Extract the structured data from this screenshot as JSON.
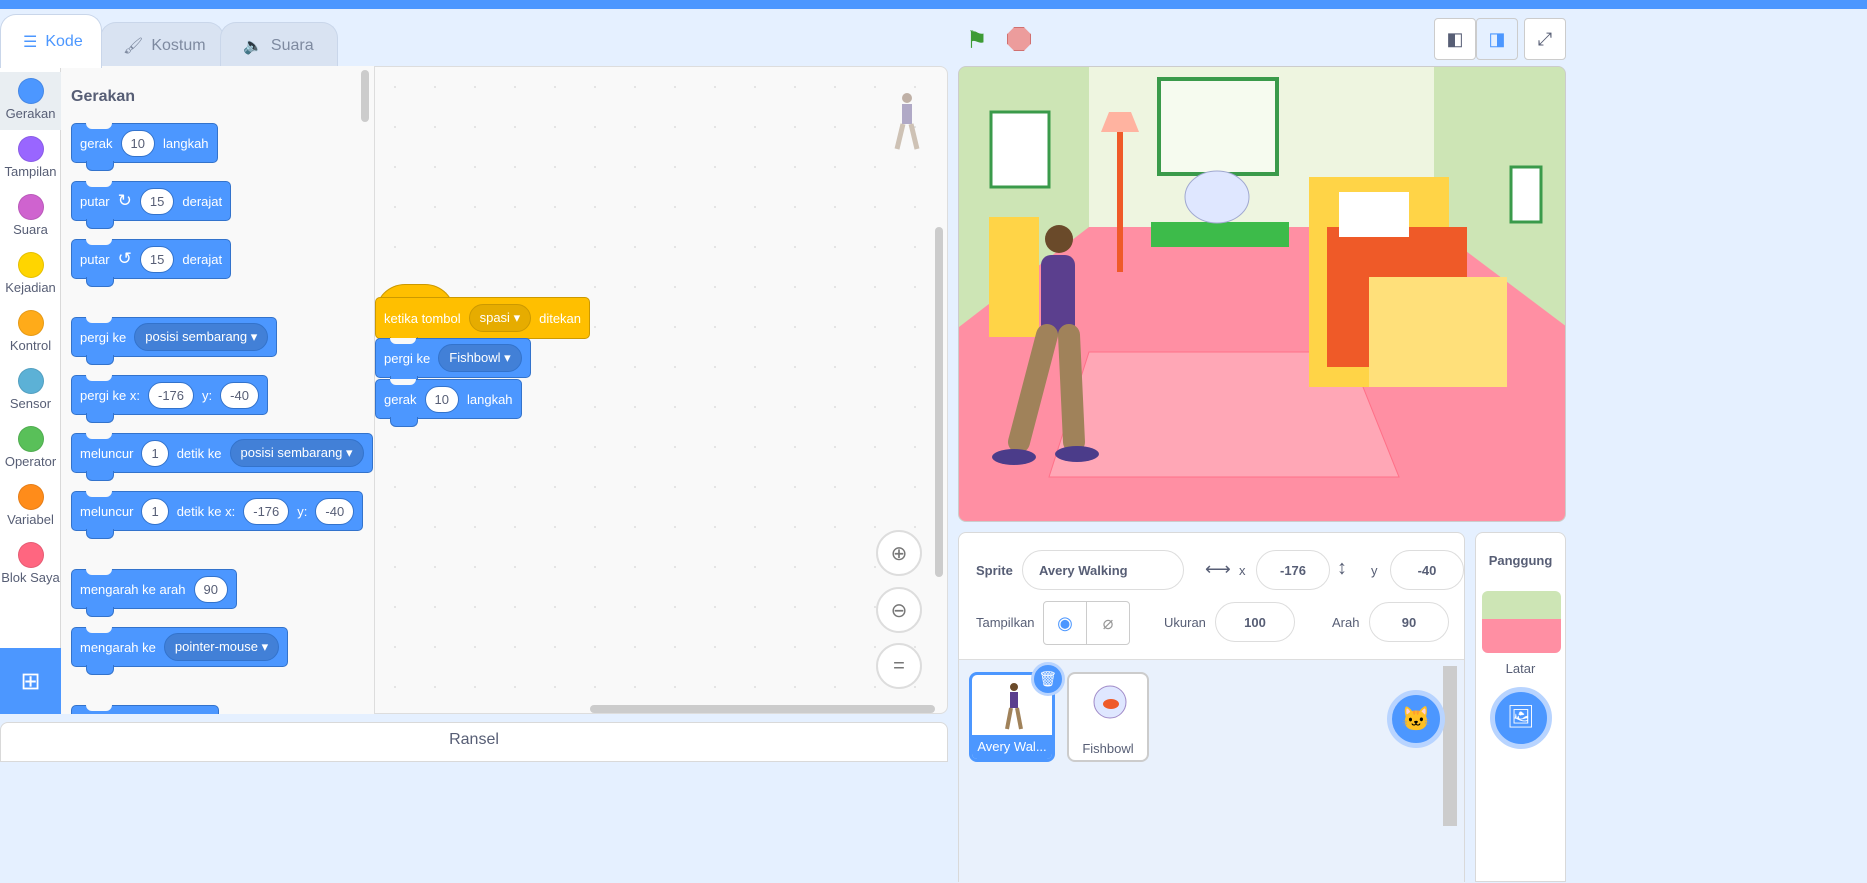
{
  "tabs": [
    {
      "label": "Kode",
      "icon": "code-icon"
    },
    {
      "label": "Kostum",
      "icon": "brush-icon"
    },
    {
      "label": "Suara",
      "icon": "speaker-icon"
    }
  ],
  "categories": [
    {
      "label": "Gerakan",
      "color": "#4c97ff"
    },
    {
      "label": "Tampilan",
      "color": "#9966ff"
    },
    {
      "label": "Suara",
      "color": "#cf63cf"
    },
    {
      "label": "Kejadian",
      "color": "#ffd500"
    },
    {
      "label": "Kontrol",
      "color": "#ffab19"
    },
    {
      "label": "Sensor",
      "color": "#5cb1d6"
    },
    {
      "label": "Operator",
      "color": "#59c059"
    },
    {
      "label": "Variabel",
      "color": "#ff8c1a"
    },
    {
      "label": "Blok Saya",
      "color": "#ff6680"
    }
  ],
  "palette": {
    "heading": "Gerakan",
    "blocks": {
      "move": {
        "a": "gerak",
        "v": "10",
        "b": "langkah"
      },
      "turn_right": {
        "a": "putar",
        "v": "15",
        "b": "derajat"
      },
      "turn_left": {
        "a": "putar",
        "v": "15",
        "b": "derajat"
      },
      "goto": {
        "a": "pergi ke",
        "dd": "posisi sembarang"
      },
      "goto_xy": {
        "a": "pergi ke x:",
        "x": "-176",
        "b": "y:",
        "y": "-40"
      },
      "glide": {
        "a": "meluncur",
        "v": "1",
        "b": "detik ke",
        "dd": "posisi sembarang"
      },
      "glide_xy": {
        "a": "meluncur",
        "v": "1",
        "b": "detik ke x:",
        "x": "-176",
        "c": "y:",
        "y": "-40"
      },
      "point_dir": {
        "a": "mengarah ke arah",
        "v": "90"
      },
      "point_to": {
        "a": "mengarah ke",
        "dd": "pointer-mouse"
      }
    }
  },
  "script": {
    "hat": {
      "a": "ketika tombol",
      "dd": "spasi",
      "b": "ditekan"
    },
    "goto": {
      "a": "pergi ke",
      "dd": "Fishbowl"
    },
    "move": {
      "a": "gerak",
      "v": "10",
      "b": "langkah"
    }
  },
  "backpack": "Ransel",
  "sprite_info": {
    "sprite_label": "Sprite",
    "sprite_name": "Avery Walking",
    "x_label": "x",
    "x": "-176",
    "y_label": "y",
    "y": "-40",
    "show_label": "Tampilkan",
    "size_label": "Ukuran",
    "size": "100",
    "direction_label": "Arah",
    "direction": "90"
  },
  "sprites": [
    {
      "name": "Avery Wal..."
    },
    {
      "name": "Fishbowl"
    }
  ],
  "stage_panel": {
    "title": "Panggung",
    "backdrops_label": "Latar"
  }
}
